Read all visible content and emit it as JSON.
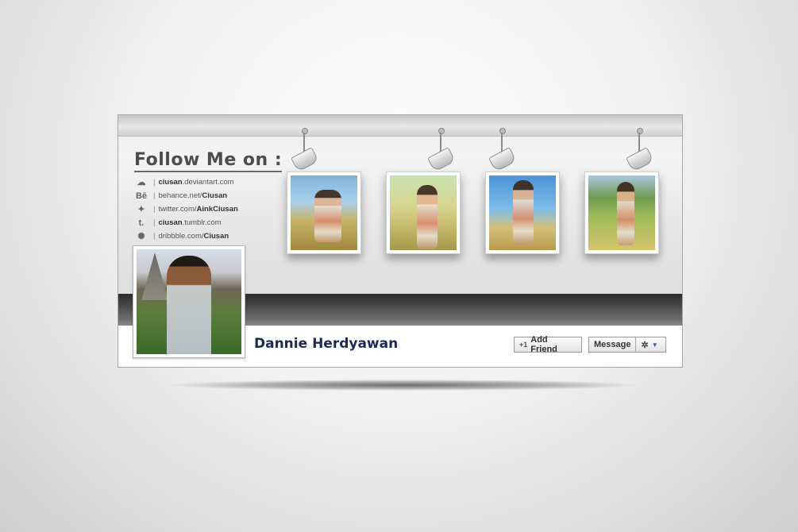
{
  "profile": {
    "name": "Dannie Herdyawan",
    "add_friend_label": "Add Friend",
    "message_label": "Message"
  },
  "follow": {
    "title": "Follow Me on :",
    "links": [
      {
        "icon": "deviantart-icon",
        "prefix": "",
        "bold": "ciusan",
        "suffix": ".deviantart.com"
      },
      {
        "icon": "behance-icon",
        "prefix": "behance.net/",
        "bold": "Ciusan",
        "suffix": ""
      },
      {
        "icon": "twitter-icon",
        "prefix": "twitter.com/",
        "bold": "AinkCiusan",
        "suffix": ""
      },
      {
        "icon": "tumblr-icon",
        "prefix": "",
        "bold": "ciusan",
        "suffix": ".tumblr.com"
      },
      {
        "icon": "dribbble-icon",
        "prefix": "dribbble.com/",
        "bold": "Ciusan",
        "suffix": ""
      }
    ]
  },
  "gallery": {
    "photos": [
      "photo-1",
      "photo-2",
      "photo-3",
      "photo-4"
    ]
  },
  "colors": {
    "name_text": "#1c2a55",
    "accent_arrow": "#3b5998"
  }
}
